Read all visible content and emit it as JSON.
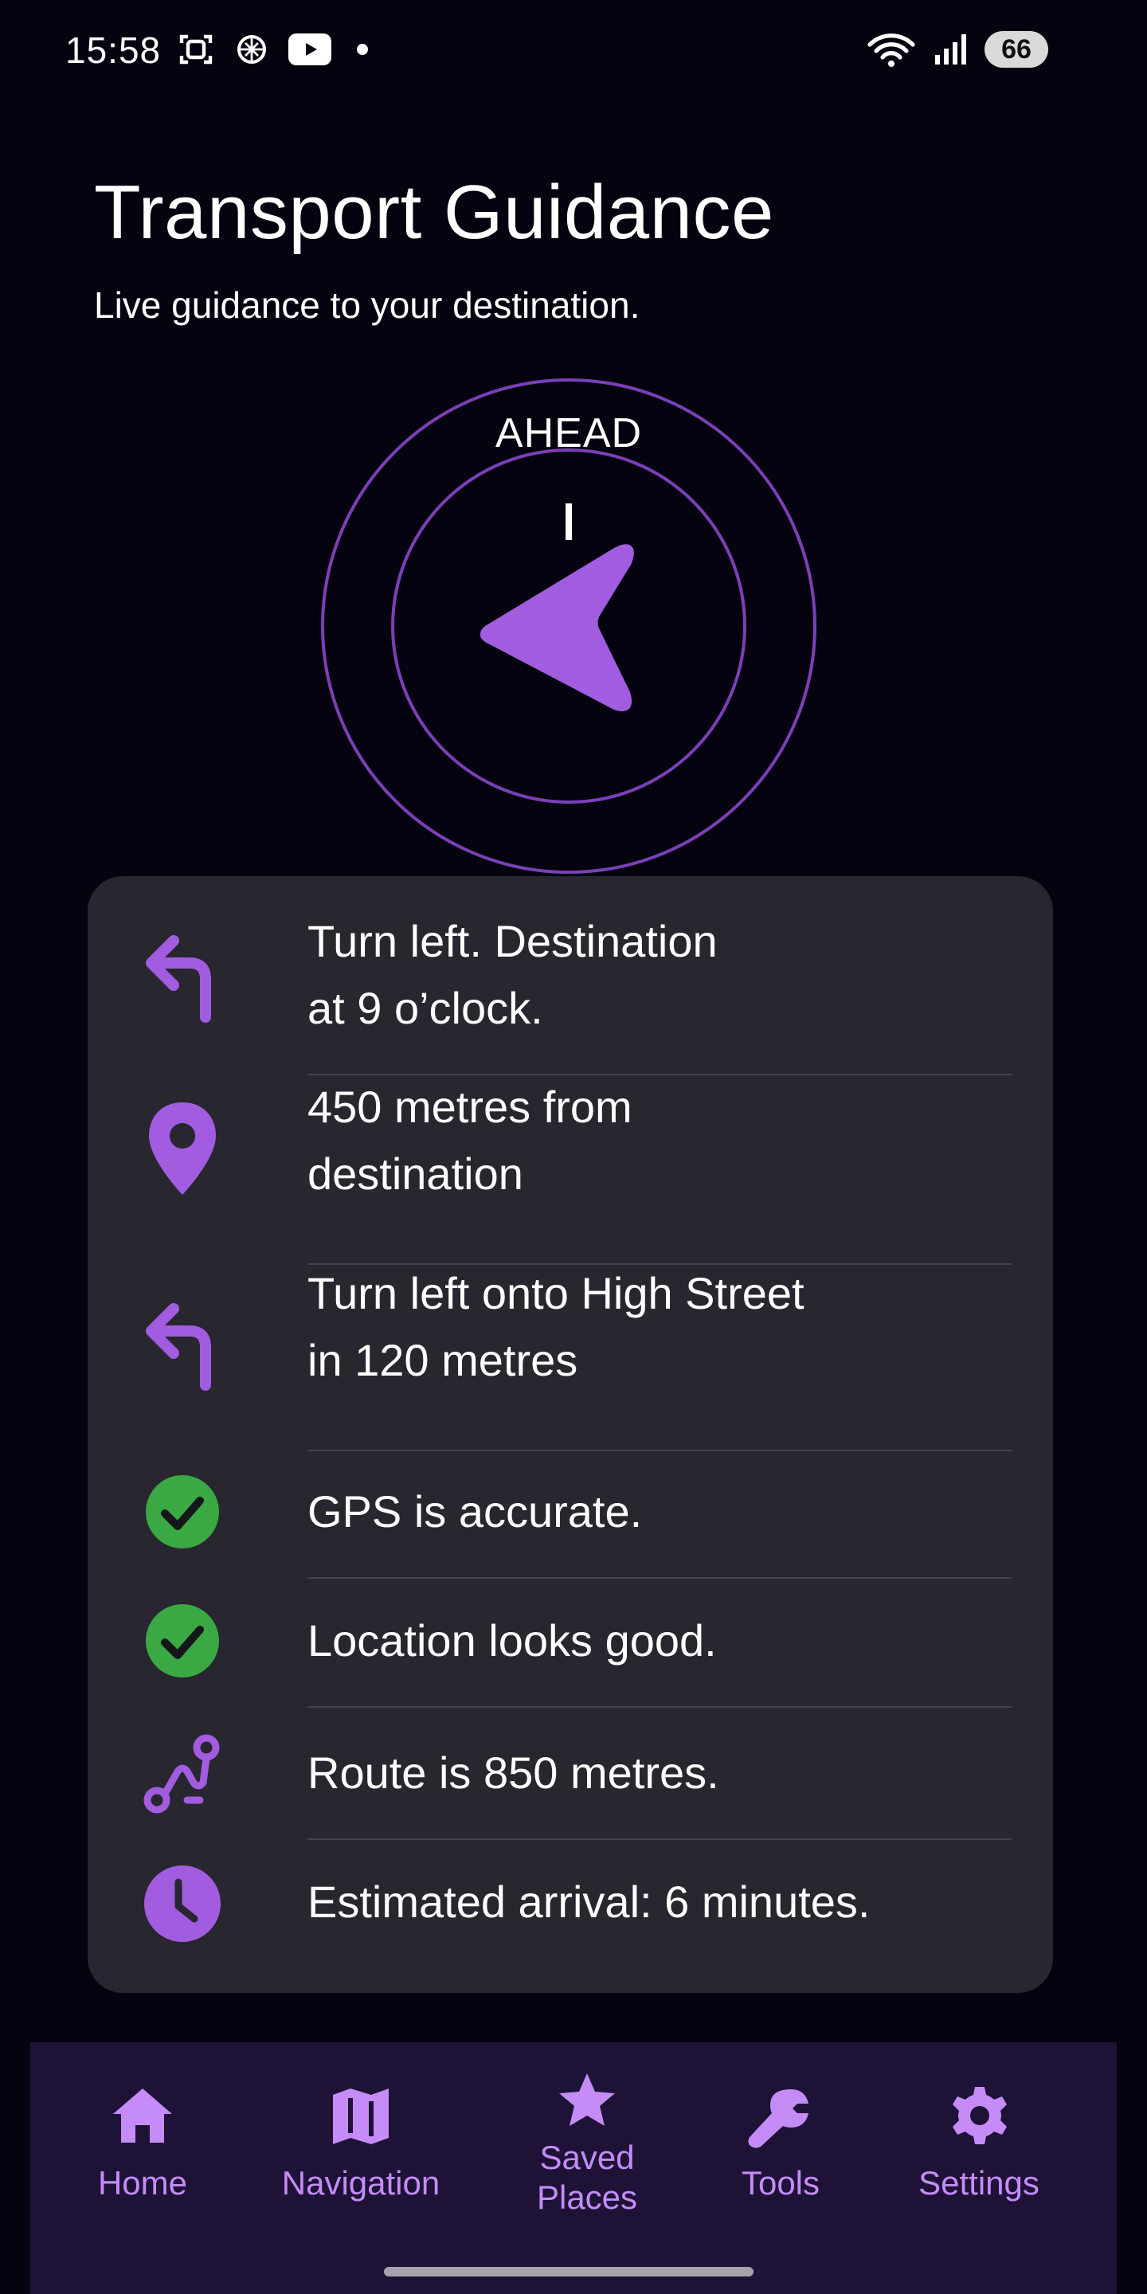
{
  "status_bar": {
    "time": "15:58",
    "battery": "66",
    "icons": [
      "screenshot-icon",
      "ai-icon",
      "youtube-icon",
      "wifi-icon",
      "signal-icon"
    ]
  },
  "header": {
    "title": "Transport Guidance",
    "subtitle": "Live guidance to your destination."
  },
  "compass": {
    "heading_label": "AHEAD",
    "arrow_direction": "left",
    "accent_color": "#7b3fb8"
  },
  "guidance": {
    "rows": [
      {
        "icon": "turn-left-icon",
        "text_line1": "Turn left. Destination",
        "text_line2": "at 9 o’clock."
      },
      {
        "icon": "location-pin-icon",
        "text_line1": "450 metres from",
        "text_line2": "destination"
      },
      {
        "icon": "turn-left-icon",
        "text_line1": "Turn left onto High Street",
        "text_line2": "in 120 metres"
      },
      {
        "icon": "check-circle-icon",
        "text_line1": "GPS is accurate."
      },
      {
        "icon": "check-circle-icon",
        "text_line1": "Location looks good."
      },
      {
        "icon": "route-icon",
        "text_line1": "Route is 850 metres."
      },
      {
        "icon": "clock-icon",
        "text_line1": "Estimated arrival: 6 minutes."
      }
    ]
  },
  "bottom_nav": {
    "items": [
      {
        "label": "Home",
        "icon": "home-icon"
      },
      {
        "label": "Navigation",
        "icon": "map-icon"
      },
      {
        "label_line1": "Saved",
        "label_line2": "Places",
        "icon": "star-icon"
      },
      {
        "label": "Tools",
        "icon": "wrench-icon"
      },
      {
        "label": "Settings",
        "icon": "gear-icon"
      }
    ]
  },
  "colors": {
    "background": "#05030f",
    "card": "#28262f",
    "accent": "#a25ce0",
    "success": "#3aa843",
    "nav_background": "#1e1337",
    "nav_text": "#c58cf7"
  }
}
